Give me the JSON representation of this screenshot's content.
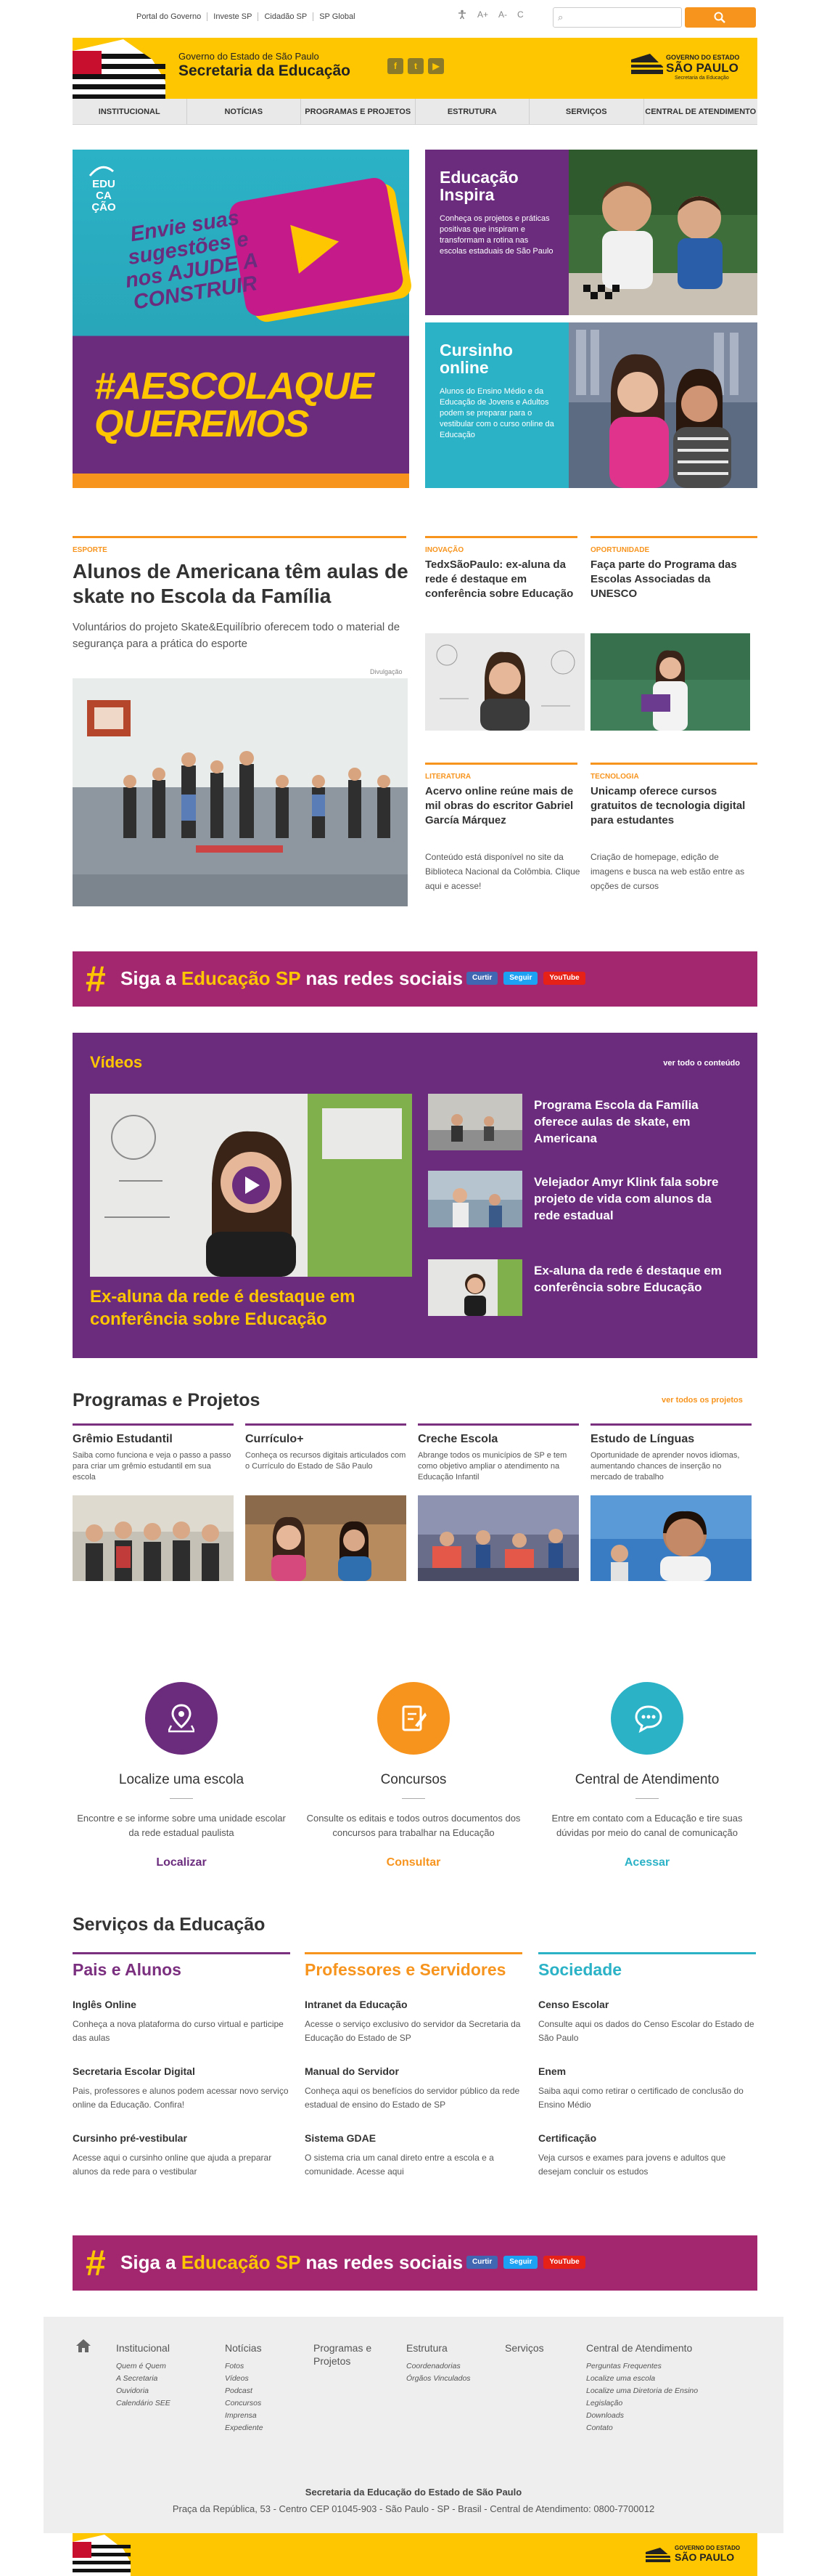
{
  "top": {
    "links": [
      "Portal do Governo",
      "Investe SP",
      "Cidadão SP",
      "SP Global"
    ],
    "accessibility": [
      "A+",
      "A-",
      "C"
    ]
  },
  "header": {
    "line1": "Governo do Estado de São Paulo",
    "title": "Secretaria da Educação",
    "gov_line1": "GOVERNO DO ESTADO",
    "gov_line2": "SÃO PAULO",
    "gov_line3": "Secretaria da Educação"
  },
  "nav": [
    "INSTITUCIONAL",
    "NOTÍCIAS",
    "PROGRAMAS E PROJETOS",
    "ESTRUTURA",
    "SERVIÇOS",
    "CENTRAL DE ATENDIMENTO"
  ],
  "hero": {
    "edu": "EDU CA ÇÃO",
    "msg": "Envie suas sugestões e nos AJUDE A CONSTRUIR",
    "tag": "#AESCOLAQUE QUEREMOS"
  },
  "cards": [
    {
      "title": "Educação Inspira",
      "text": "Conheça os projetos e práticas positivas que inspiram e transformam a rotina nas escolas estaduais de São Paulo",
      "color": "#6b2c7e"
    },
    {
      "title": "Cursinho online",
      "text": "Alunos do Ensino Médio e da Educação de Jovens e Adultos podem se preparar para o vestibular com o curso online da Educação",
      "color": "#2bb2c7"
    }
  ],
  "news_main": {
    "category": "ESPORTE",
    "title": "Alunos de Americana têm aulas de skate no Escola da Família",
    "lead": "Voluntários do projeto Skate&Equilíbrio oferecem todo o material de segurança para a prática do esporte",
    "credit": "Divulgação"
  },
  "news": [
    {
      "category": "INOVAÇÃO",
      "title": "TedxSãoPaulo: ex-aluna da rede é destaque em conferência sobre Educação"
    },
    {
      "category": "OPORTUNIDADE",
      "title": "Faça parte do Programa das Escolas Associadas da UNESCO"
    },
    {
      "category": "LITERATURA",
      "title": "Acervo online reúne mais de mil obras do escritor Gabriel García Márquez",
      "text": "Conteúdo está disponível no site da Biblioteca Nacional da Colômbia. Clique aqui e acesse!"
    },
    {
      "category": "TECNOLOGIA",
      "title": "Unicamp oferece cursos gratuitos de tecnologia digital para estudantes",
      "text": "Criação de homepage, edição de imagens e busca na web estão entre as opções de cursos"
    }
  ],
  "banner": {
    "hash": "#",
    "pre": "Siga a ",
    "highlight": "Educação SP",
    "post": " nas redes sociais",
    "curtir": "Curtir",
    "seguir": "Seguir",
    "youtube": "YouTube"
  },
  "videos": {
    "title": "Vídeos",
    "all": "ver todo o conteúdo",
    "main_caption": "Ex-aluna da rede é destaque em conferência sobre Educação",
    "items": [
      "Programa Escola da Família oferece aulas de skate, em Americana",
      "Velejador Amyr Klink fala sobre projeto de vida com alunos da rede estadual",
      "Ex-aluna da rede é destaque em conferência sobre Educação"
    ]
  },
  "programs": {
    "title": "Programas e Projetos",
    "more": "ver todos os projetos",
    "items": [
      {
        "title": "Grêmio Estudantil",
        "text": "Saiba como funciona e veja o passo a passo para criar um grêmio estudantil em sua escola"
      },
      {
        "title": "Currículo+",
        "text": "Conheça os recursos digitais articulados com o Currículo do Estado de São Paulo"
      },
      {
        "title": "Creche Escola",
        "text": "Abrange todos os municípios de SP e tem como objetivo ampliar o atendimento na Educação Infantil"
      },
      {
        "title": "Estudo de Línguas",
        "text": "Oportunidade de aprender novos idiomas, aumentando chances de inserção no mercado de trabalho"
      }
    ]
  },
  "actions": [
    {
      "title": "Localize uma escola",
      "text": "Encontre e se informe sobre uma unidade escolar da rede estadual paulista",
      "link": "Localizar",
      "color": "#6b2c7e"
    },
    {
      "title": "Concursos",
      "text": "Consulte os editais e todos outros documentos dos concursos para trabalhar na Educação",
      "link": "Consultar",
      "color": "#f7941d"
    },
    {
      "title": "Central de Atendimento",
      "text": "Entre em contato com a Educação e tire suas dúvidas por meio do canal de comunicação",
      "link": "Acessar",
      "color": "#2bb2c7"
    }
  ],
  "services": {
    "title": "Serviços da Educação",
    "cols": [
      {
        "title": "Pais e Alunos",
        "color": "#7b2f7f",
        "items": [
          {
            "t": "Inglês Online",
            "d": "Conheça a nova plataforma do curso virtual e participe das aulas"
          },
          {
            "t": "Secretaria Escolar Digital",
            "d": "Pais, professores e alunos podem acessar novo serviço online da Educação. Confira!"
          },
          {
            "t": "Cursinho pré-vestibular",
            "d": "Acesse aqui o cursinho online que ajuda a preparar alunos da rede para o vestibular"
          }
        ]
      },
      {
        "title": "Professores e Servidores",
        "color": "#f7941d",
        "items": [
          {
            "t": "Intranet da Educação",
            "d": "Acesse o serviço exclusivo do servidor da Secretaria da Educação do Estado de SP"
          },
          {
            "t": "Manual do Servidor",
            "d": "Conheça aqui os benefícios do servidor público da rede estadual de ensino do Estado de SP"
          },
          {
            "t": "Sistema GDAE",
            "d": "O sistema cria um canal direto entre a escola e a comunidade. Acesse aqui"
          }
        ]
      },
      {
        "title": "Sociedade",
        "color": "#2bb2c7",
        "items": [
          {
            "t": "Censo Escolar",
            "d": "Consulte aqui os dados do Censo Escolar do Estado de São Paulo"
          },
          {
            "t": "Enem",
            "d": "Saiba aqui como retirar o certificado de conclusão do Ensino Médio"
          },
          {
            "t": "Certificação",
            "d": "Veja cursos e exames para jovens e adultos que desejam concluir os estudos"
          }
        ]
      }
    ]
  },
  "footer": {
    "cols": [
      {
        "h": "Institucional",
        "items": [
          "Quem é Quem",
          "A Secretaria",
          "Ouvidoria",
          "Calendário SEE"
        ]
      },
      {
        "h": "Notícias",
        "items": [
          "Fotos",
          "Vídeos",
          "Podcast",
          "Concursos",
          "Imprensa",
          "Expediente"
        ]
      },
      {
        "h": "Programas e Projetos",
        "items": []
      },
      {
        "h": "Estrutura",
        "items": [
          "Coordenadorias",
          "Órgãos Vinculados"
        ]
      },
      {
        "h": "Serviços",
        "items": []
      },
      {
        "h": "Central de Atendimento",
        "items": [
          "Perguntas Frequentes",
          "Localize uma escola",
          "Localize uma Diretoria de Ensino",
          "Legislação",
          "Downloads",
          "Contato"
        ]
      }
    ],
    "org": "Secretaria da Educação do Estado de São Paulo",
    "address": "Praça da República, 53 - Centro CEP 01045-903 - São Paulo - SP - Brasil - Central de Atendimento: 0800-7700012"
  }
}
